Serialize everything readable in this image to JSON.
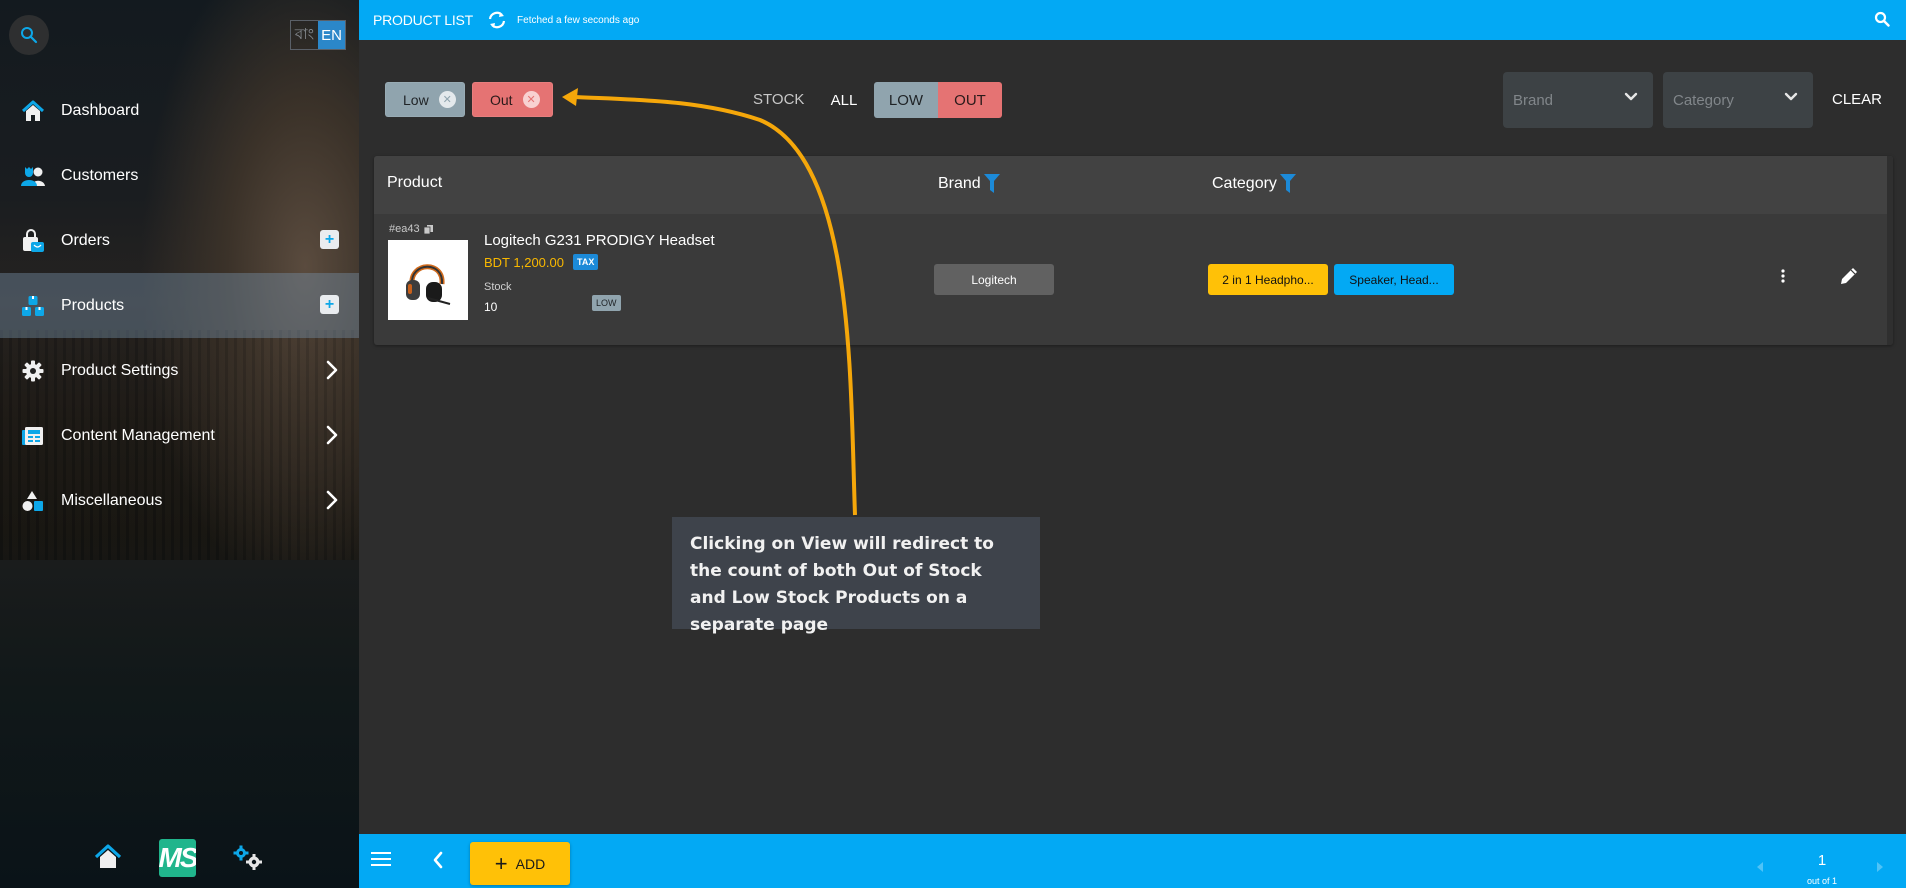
{
  "sidebar": {
    "language": {
      "bn_label": "বাং",
      "en_label": "EN",
      "active": "EN"
    },
    "items": [
      {
        "label": "Dashboard",
        "icon": "home-icon",
        "action": null,
        "active": false
      },
      {
        "label": "Customers",
        "icon": "customers-icon",
        "action": null,
        "active": false
      },
      {
        "label": "Orders",
        "icon": "orders-icon",
        "action": "plus",
        "active": false
      },
      {
        "label": "Products",
        "icon": "products-icon",
        "action": "plus",
        "active": true
      },
      {
        "label": "Product Settings",
        "icon": "gear-icon",
        "action": "chevron",
        "active": false
      },
      {
        "label": "Content Management",
        "icon": "content-icon",
        "action": "chevron",
        "active": false
      },
      {
        "label": "Miscellaneous",
        "icon": "shapes-icon",
        "action": "chevron",
        "active": false
      }
    ],
    "bottom": {
      "logo_text": "MS"
    }
  },
  "header": {
    "title": "PRODUCT LIST",
    "fetched": "Fetched a few seconds ago"
  },
  "filters": {
    "chips": [
      {
        "label": "Low",
        "color": "#90a4ae"
      },
      {
        "label": "Out",
        "color": "#e57373"
      }
    ],
    "stock_label": "STOCK",
    "stock_options": {
      "all": "ALL",
      "low": "LOW",
      "out": "OUT"
    },
    "brand_placeholder": "Brand",
    "category_placeholder": "Category",
    "clear_label": "CLEAR"
  },
  "table": {
    "columns": {
      "product": "Product",
      "brand": "Brand",
      "category": "Category"
    },
    "rows": [
      {
        "id": "#ea43",
        "name": "Logitech G231 PRODIGY Headset",
        "price": "BDT 1,200.00",
        "tax_badge": "TAX",
        "stock_label": "Stock",
        "stock": "10",
        "stock_status": "LOW",
        "brand": "Logitech",
        "categories": [
          "2 in 1 Headpho...",
          "Speaker, Head..."
        ]
      }
    ]
  },
  "annotation": {
    "text": "Clicking on View will redirect to the count of both Out of Stock and Low Stock Products on a separate page"
  },
  "footer": {
    "add_label": "ADD",
    "page": "1",
    "page_of": "out of 1"
  },
  "colors": {
    "primary": "#03a9f4",
    "accent": "#ffc107",
    "low": "#90a4ae",
    "out": "#e57373",
    "arrow": "#f5a70a"
  }
}
